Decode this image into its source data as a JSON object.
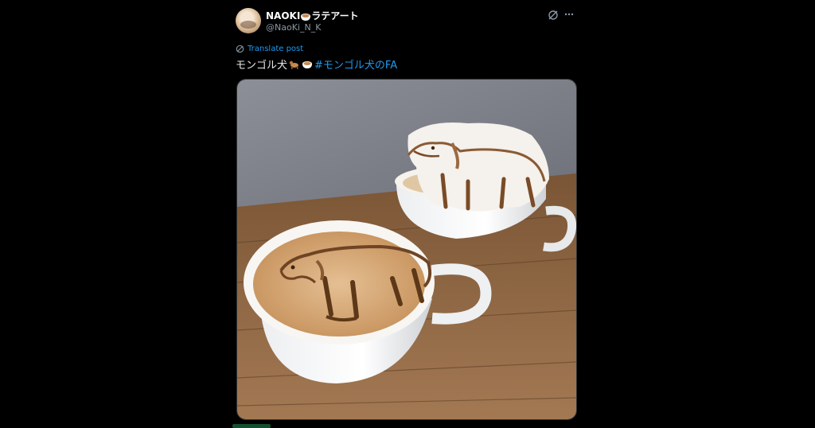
{
  "post": {
    "author_name": "NAOKIラテアート",
    "author_handle": "@NaoKi_N_K",
    "translate_label": "Translate post",
    "text": "モンゴル犬",
    "hashtag": "#モンゴル犬のFA"
  },
  "icons": {
    "grok": "grok-icon",
    "more": "more-icon",
    "translate": "translate-icon",
    "dog_emoji": "dog-emoji-icon",
    "latte_emoji": "latte-emoji-icon"
  },
  "colors": {
    "background": "#000000",
    "text": "#e7e9ea",
    "secondary": "#8b98a5",
    "link": "#1d9bf0"
  }
}
